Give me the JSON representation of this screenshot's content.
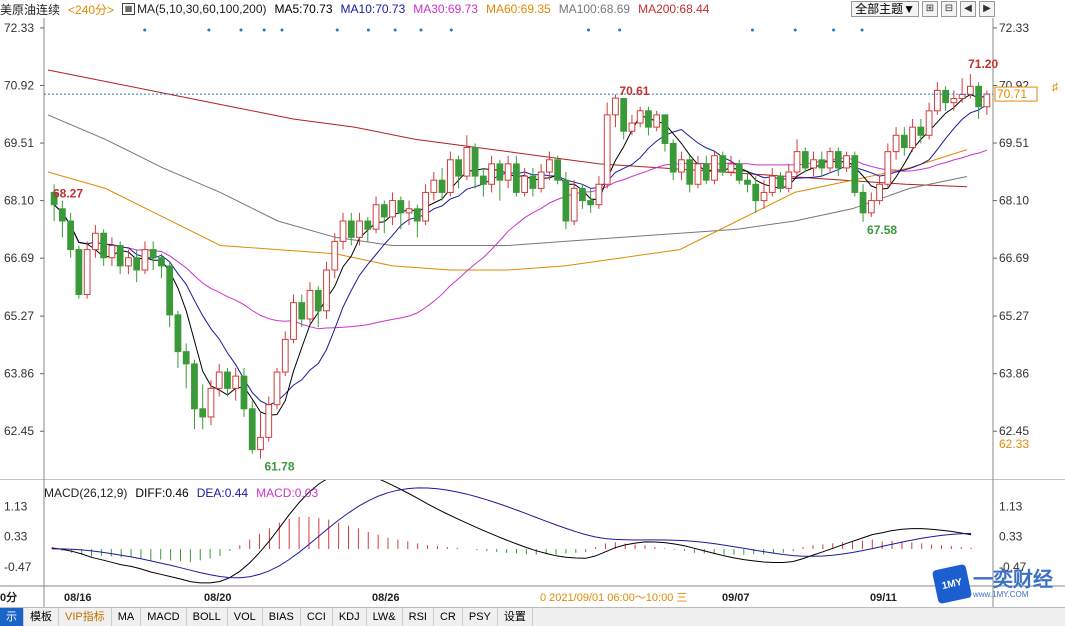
{
  "legend": {
    "symbol": "美原油连续",
    "period": "<240分>",
    "ma_set_icon": "ma-chart-icon",
    "ma_set": "MA(5,10,30,60,100,200)",
    "ma5": "MA5:70.73",
    "ma10": "MA10:70.73",
    "ma30": "MA30:69.73",
    "ma60": "MA60:69.35",
    "ma100": "MA100:68.69",
    "ma200": "MA200:68.44"
  },
  "toolbar": {
    "theme_button": "全部主题▼",
    "btn1": "⊞",
    "btn2": "⊟",
    "btn3": "◀",
    "btn4": "▶"
  },
  "price_axis": {
    "ticks": [
      "72.33",
      "70.92",
      "69.51",
      "68.10",
      "66.69",
      "65.27",
      "63.86",
      "62.45"
    ],
    "current": "70.71",
    "low_tag": "62.33"
  },
  "macd_axis": {
    "ticks": [
      "1.13",
      "0.33",
      "-0.47"
    ]
  },
  "annotations": {
    "high1": "70.61",
    "high2": "71.20",
    "start": "68.27",
    "low1": "61.78",
    "low2": "67.58"
  },
  "macd_legend": {
    "name": "MACD(26,12,9)",
    "diff": "DIFF:0.46",
    "dea": "DEA:0.44",
    "macd": "MACD:0.03"
  },
  "dates": {
    "d1": "08/16",
    "d2": "08/20",
    "d3": "08/26",
    "d4": "09/07",
    "d5": "09/11",
    "left_cut": "0分",
    "cursor": "0  2021/09/01 06:00～10:00 三"
  },
  "bottom_tabs": [
    "示",
    "模板",
    "VIP指标",
    "MA",
    "MACD",
    "BOLL",
    "VOL",
    "BIAS",
    "CCI",
    "KDJ",
    "LW&",
    "RSI",
    "CR",
    "PSY",
    "设置"
  ],
  "logo": {
    "text": "一奕财经",
    "sub": "www.1MY.COM",
    "badge": "1MY"
  },
  "colors": {
    "up": "#d23c3c",
    "down": "#3a9a3a",
    "ma5": "#000000",
    "ma10": "#1a1aa0",
    "ma30": "#cc33cc",
    "ma60": "#e08a00",
    "ma100": "#777777",
    "ma200": "#b22020"
  },
  "chart_data": {
    "type": "candlestick",
    "ylim": [
      61.5,
      72.5
    ],
    "macd_ylim": [
      -0.9,
      1.3
    ],
    "candles": [
      [
        68.3,
        68.0,
        68.5,
        67.6
      ],
      [
        67.9,
        67.6,
        68.1,
        67.2
      ],
      [
        67.6,
        66.9,
        67.8,
        66.7
      ],
      [
        66.9,
        65.8,
        67.0,
        65.7
      ],
      [
        65.8,
        66.9,
        67.1,
        65.7
      ],
      [
        66.9,
        67.3,
        67.5,
        66.7
      ],
      [
        67.3,
        66.7,
        67.4,
        66.5
      ],
      [
        66.7,
        67.0,
        67.2,
        66.5
      ],
      [
        67.0,
        66.5,
        67.1,
        66.3
      ],
      [
        66.5,
        66.7,
        66.9,
        66.3
      ],
      [
        66.7,
        66.4,
        66.9,
        66.1
      ],
      [
        66.4,
        66.9,
        67.1,
        66.3
      ],
      [
        66.9,
        66.7,
        67.1,
        66.4
      ],
      [
        66.7,
        66.5,
        66.8,
        66.2
      ],
      [
        66.5,
        65.3,
        66.6,
        65.0
      ],
      [
        65.3,
        64.4,
        65.4,
        64.0
      ],
      [
        64.4,
        64.1,
        64.6,
        63.5
      ],
      [
        64.1,
        63.0,
        64.2,
        62.5
      ],
      [
        63.0,
        62.8,
        63.6,
        62.5
      ],
      [
        62.8,
        63.5,
        63.7,
        62.6
      ],
      [
        63.5,
        63.9,
        64.1,
        63.3
      ],
      [
        63.9,
        63.5,
        64.0,
        63.3
      ],
      [
        63.5,
        63.8,
        64.0,
        63.2
      ],
      [
        63.8,
        63.0,
        64.0,
        62.8
      ],
      [
        63.0,
        62.0,
        63.2,
        61.9
      ],
      [
        62.0,
        62.3,
        62.9,
        61.78
      ],
      [
        62.3,
        63.1,
        63.3,
        62.2
      ],
      [
        63.1,
        63.9,
        64.0,
        63.0
      ],
      [
        63.9,
        64.7,
        64.9,
        63.8
      ],
      [
        64.7,
        65.6,
        65.8,
        64.6
      ],
      [
        65.6,
        65.2,
        65.8,
        65.0
      ],
      [
        65.2,
        65.9,
        66.1,
        65.1
      ],
      [
        65.9,
        65.4,
        66.0,
        65.0
      ],
      [
        65.4,
        66.4,
        66.6,
        65.2
      ],
      [
        66.4,
        67.1,
        67.3,
        66.2
      ],
      [
        67.1,
        67.6,
        67.8,
        66.9
      ],
      [
        67.6,
        67.2,
        67.8,
        67.0
      ],
      [
        67.2,
        67.6,
        67.8,
        67.0
      ],
      [
        67.6,
        67.4,
        67.7,
        67.1
      ],
      [
        67.4,
        68.0,
        68.2,
        67.3
      ],
      [
        68.0,
        67.7,
        68.1,
        67.3
      ],
      [
        67.7,
        68.1,
        68.3,
        67.5
      ],
      [
        68.1,
        67.8,
        68.2,
        67.4
      ],
      [
        67.8,
        67.9,
        68.1,
        67.5
      ],
      [
        67.9,
        67.6,
        68.0,
        67.2
      ],
      [
        67.6,
        68.3,
        68.5,
        67.5
      ],
      [
        68.3,
        68.6,
        68.8,
        68.1
      ],
      [
        68.6,
        68.3,
        68.9,
        68.1
      ],
      [
        68.3,
        69.1,
        69.3,
        68.2
      ],
      [
        69.1,
        68.7,
        69.2,
        68.4
      ],
      [
        68.7,
        69.4,
        69.7,
        68.6
      ],
      [
        69.4,
        68.7,
        69.5,
        68.4
      ],
      [
        68.7,
        68.5,
        68.9,
        68.2
      ],
      [
        68.5,
        69.0,
        69.2,
        68.3
      ],
      [
        69.0,
        68.6,
        69.1,
        68.1
      ],
      [
        68.6,
        69.0,
        69.2,
        68.4
      ],
      [
        69.0,
        68.3,
        69.2,
        68.2
      ],
      [
        68.3,
        68.7,
        68.9,
        68.2
      ],
      [
        68.7,
        68.4,
        68.9,
        68.2
      ],
      [
        68.4,
        68.8,
        69.0,
        68.3
      ],
      [
        68.8,
        69.1,
        69.3,
        68.6
      ],
      [
        69.1,
        68.6,
        69.2,
        68.5
      ],
      [
        68.6,
        67.6,
        68.8,
        67.4
      ],
      [
        67.6,
        68.4,
        68.6,
        67.5
      ],
      [
        68.4,
        68.1,
        68.5,
        67.9
      ],
      [
        68.1,
        68.0,
        68.4,
        67.8
      ],
      [
        68.0,
        68.5,
        68.7,
        67.9
      ],
      [
        68.5,
        70.2,
        70.5,
        68.4
      ],
      [
        70.2,
        70.61,
        70.7,
        69.9
      ],
      [
        70.6,
        69.8,
        70.6,
        69.6
      ],
      [
        69.8,
        70.0,
        70.2,
        69.7
      ],
      [
        70.0,
        70.3,
        70.4,
        69.9
      ],
      [
        70.3,
        69.9,
        70.4,
        69.7
      ],
      [
        69.9,
        70.2,
        70.3,
        69.8
      ],
      [
        70.2,
        69.5,
        70.2,
        69.3
      ],
      [
        69.5,
        68.8,
        69.6,
        68.6
      ],
      [
        68.8,
        69.1,
        69.3,
        68.6
      ],
      [
        69.1,
        68.5,
        69.2,
        68.3
      ],
      [
        68.5,
        69.0,
        69.2,
        68.4
      ],
      [
        69.0,
        68.6,
        69.2,
        68.5
      ],
      [
        68.6,
        69.2,
        69.3,
        68.5
      ],
      [
        69.2,
        68.8,
        69.3,
        68.7
      ],
      [
        68.8,
        69.0,
        69.2,
        68.7
      ],
      [
        69.0,
        68.6,
        69.1,
        68.5
      ],
      [
        68.6,
        68.5,
        68.8,
        68.3
      ],
      [
        68.5,
        68.1,
        68.7,
        67.8
      ],
      [
        68.1,
        68.3,
        68.6,
        67.9
      ],
      [
        68.3,
        68.7,
        68.9,
        68.2
      ],
      [
        68.7,
        68.4,
        68.8,
        68.3
      ],
      [
        68.4,
        68.8,
        69.0,
        68.3
      ],
      [
        68.8,
        69.3,
        69.6,
        68.7
      ],
      [
        69.3,
        68.9,
        69.4,
        68.8
      ],
      [
        68.9,
        69.1,
        69.3,
        68.7
      ],
      [
        69.1,
        68.9,
        69.3,
        68.7
      ],
      [
        68.9,
        69.3,
        69.4,
        68.8
      ],
      [
        69.3,
        68.9,
        69.4,
        68.7
      ],
      [
        68.9,
        69.2,
        69.3,
        68.8
      ],
      [
        69.2,
        68.3,
        69.3,
        68.2
      ],
      [
        68.3,
        67.8,
        68.5,
        67.58
      ],
      [
        67.8,
        68.1,
        68.3,
        67.7
      ],
      [
        68.1,
        68.5,
        68.7,
        68.0
      ],
      [
        68.5,
        69.3,
        69.5,
        68.4
      ],
      [
        69.3,
        69.7,
        69.9,
        69.1
      ],
      [
        69.7,
        69.4,
        69.9,
        69.2
      ],
      [
        69.4,
        69.9,
        70.1,
        69.3
      ],
      [
        69.9,
        69.7,
        70.1,
        69.5
      ],
      [
        69.7,
        70.3,
        70.5,
        69.6
      ],
      [
        70.3,
        70.8,
        71.0,
        70.2
      ],
      [
        70.8,
        70.5,
        70.9,
        70.3
      ],
      [
        70.5,
        70.6,
        70.8,
        70.3
      ],
      [
        70.6,
        70.7,
        71.1,
        70.5
      ],
      [
        70.7,
        70.9,
        71.2,
        70.6
      ],
      [
        70.9,
        70.4,
        71.0,
        70.1
      ],
      [
        70.4,
        70.71,
        70.8,
        70.2
      ]
    ],
    "macd_hist": [
      0.05,
      -0.05,
      -0.1,
      -0.15,
      -0.2,
      -0.18,
      -0.2,
      -0.22,
      -0.2,
      -0.25,
      -0.3,
      -0.28,
      -0.3,
      -0.32,
      -0.35,
      -0.3,
      -0.25,
      -0.18,
      -0.05,
      0.1,
      0.25,
      0.4,
      0.55,
      0.7,
      0.8,
      0.85,
      0.85,
      0.82,
      0.78,
      0.7,
      0.62,
      0.55,
      0.45,
      0.38,
      0.3,
      0.25,
      0.2,
      0.15,
      0.1,
      0.08,
      0.05,
      0.03,
      0.0,
      -0.03,
      -0.05,
      -0.08,
      -0.1,
      -0.12,
      -0.14,
      -0.15,
      -0.14,
      -0.15,
      -0.12,
      -0.1,
      -0.08,
      0.05,
      0.15,
      0.18,
      0.15,
      0.12,
      0.1,
      0.05,
      0.02,
      -0.02,
      -0.05,
      -0.1,
      -0.12,
      -0.14,
      -0.15,
      -0.15,
      -0.15,
      -0.14,
      -0.14,
      -0.12,
      -0.1,
      -0.05,
      0.05,
      0.1,
      0.12,
      0.15,
      0.18,
      0.2,
      0.22,
      0.25,
      0.2,
      0.22,
      0.2,
      0.18,
      0.15,
      0.12,
      0.1,
      0.08,
      0.05,
      0.03
    ]
  }
}
